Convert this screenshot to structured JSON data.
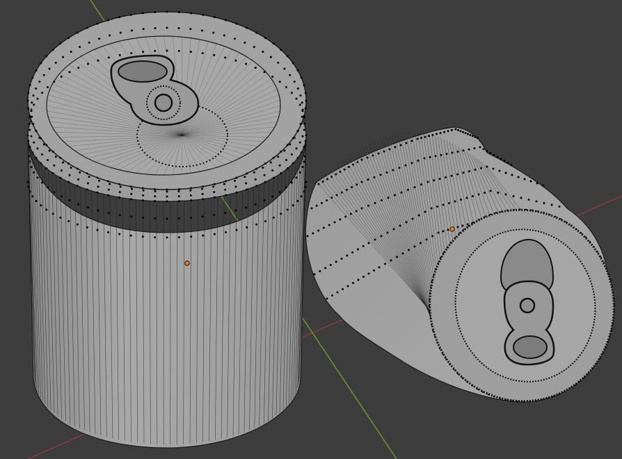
{
  "viewport": {
    "background": "#3d3d3d",
    "axis_x_color": "#8a3b45",
    "axis_y_color": "#6a9a2a",
    "mesh_fill": "#a6a6a6",
    "mesh_fill_dark": "#8c8c8c",
    "wire_color": "#1a1a1a",
    "vertex_color": "#000000",
    "origin_color": "#e87d22"
  },
  "objects": [
    {
      "name": "can-upright",
      "icon": "mesh-object-icon"
    },
    {
      "name": "can-crushed",
      "icon": "mesh-object-icon"
    }
  ]
}
